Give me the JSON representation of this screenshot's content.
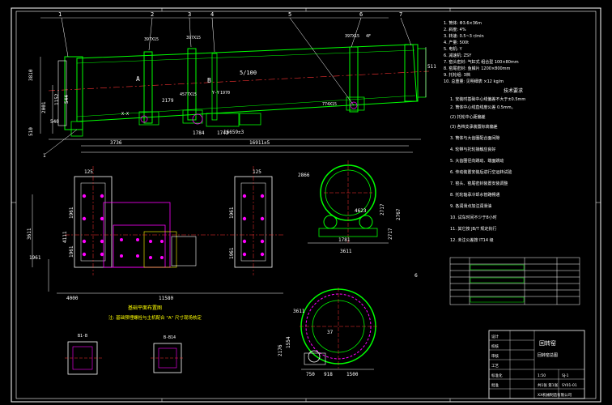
{
  "colors": {
    "background": "#000000",
    "frame": "#ffffff",
    "drum": "#00ff00",
    "ring": "#00ff00",
    "dimension": "#ffffff",
    "base": "#ff00ff",
    "anchor": "#ff00ff",
    "note_text": "#ffff00",
    "axis": "#ff3333",
    "leader": "#ffffff"
  },
  "elevation": {
    "callouts": [
      "1",
      "2",
      "3",
      "4",
      "5",
      "6",
      "7"
    ],
    "bearing_tags": [
      "397X15",
      "397X15",
      "397X15",
      "4F"
    ],
    "dims_top": [
      "5/100"
    ],
    "dims_left": [
      "3810",
      "2001",
      "1152",
      "510",
      "540",
      "544"
    ],
    "dims_mid": [
      "2179",
      "4577X15",
      "1970",
      "1784",
      "1742",
      "774X15",
      "X-X"
    ],
    "dims_bottom": [
      "3736",
      "16659±3",
      "16911±5"
    ],
    "labels": [
      "A",
      "B",
      "1",
      "Y-Y"
    ],
    "right_dim": "511"
  },
  "foundation": {
    "title_dim_left": "125",
    "title_dim_right": "125",
    "dims_left": [
      "3611",
      "1961",
      "4111",
      "1961",
      "1961"
    ],
    "dims_bottom": [
      "4000",
      "11580"
    ],
    "dims_right": [
      "1961",
      "1961"
    ],
    "note_line1": "基础平面布置图",
    "note_line2": "注: 基础预埋螺栓与主机配合 \"A\" 尺寸现场核定"
  },
  "section_a": {
    "dims": [
      "2866",
      "3611",
      "1781",
      "4623",
      "2717",
      "2717",
      "2767"
    ]
  },
  "section_b": {
    "dims": [
      "3611",
      "1554",
      "2176",
      "750",
      "918",
      "1500",
      "37"
    ]
  },
  "detail_labels": [
    "B1-B",
    "B-B14"
  ],
  "technical_specs": {
    "title": "技术参数",
    "items": [
      "1. 筒体: Φ3.6×36m",
      "2. 斜度: 4%",
      "3. 转速: 0.5~3 r/min",
      "4. 产量: 500t",
      "5. 电机: Y",
      "6. 减速机: ZSY",
      "7. 窑头密封: 气缸式 组合型 100×80mm",
      "8. 窑尾密封: 鱼鳞片 1200×800mm",
      "9. 托轮组: 3档",
      "10. 总重量: 见明细表 ×12 kg/m"
    ]
  },
  "tech_requirements": {
    "title": "技术要求",
    "items": [
      "1. 安装时基础中心线偏差不大于±0.5mm",
      "2. 筒体中心线直线度公差 0.5mm。",
      "(2) 托轮中心距偏差",
      "(3) 各档支承装置标高偏差",
      "3. 筒体与大齿圈配合面间隙",
      "4. 轮带与托轮接触应良好",
      "5. 大齿圈径向跳动、端面跳动",
      "6. 传动装置安装后进行空运转试验",
      "7. 窑头、窑尾密封装置安装调整",
      "8. 托轮轴承冷却水管路畅通",
      "9. 各润滑点加注润滑油",
      "10. 试车时间不少于8小时",
      "11. 其它按 JB/T 规定执行",
      "12. 未注公差按 IT14 级"
    ],
    "ref_number": "6"
  },
  "title_block": {
    "project": "回转窑总图",
    "drawing_title": "回转窑",
    "drawing_no": "SJ-1",
    "scale": "1:50",
    "sheet": "共1张 第1张",
    "rows": [
      "设计",
      "校核",
      "审核",
      "工艺",
      "标准化",
      "批准"
    ],
    "company": "XX机械制造有限公司",
    "bottom_code": "SY01-01"
  }
}
